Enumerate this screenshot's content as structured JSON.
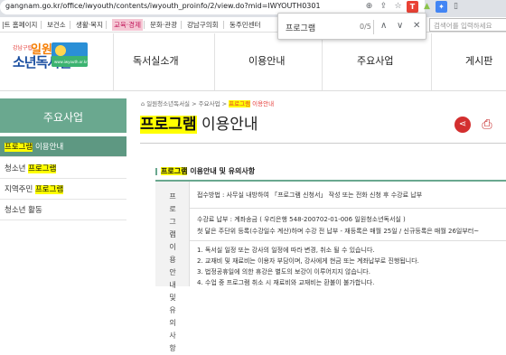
{
  "browser": {
    "url": "gangnam.go.kr/office/iwyouth/contents/iwyouth_proinfo/2/view.do?mid=IWYOUTH0301",
    "find_query": "프로그램",
    "find_count": "0/5",
    "bookmarks": [
      "|트 홈페이지",
      "보건소",
      "생활·복지",
      "교육·경제",
      "문화·관광",
      "강남구의회",
      "동주민센터"
    ],
    "active_bookmark_index": 3,
    "search_placeholder": "검색어를 입력하세요"
  },
  "logo": {
    "small": "강남구립",
    "big": "일원",
    "main": "소년독서실",
    "mark_text": "www.iwyouth.or.kr"
  },
  "nav": [
    "독서실소개",
    "이용안내",
    "주요사업",
    "게시판"
  ],
  "sidebar": {
    "title": "주요사업",
    "items": [
      {
        "pre": "",
        "hl": "프로그램",
        "post": " 이용안내"
      },
      {
        "pre": "청소년 ",
        "hl": "프로그램",
        "post": ""
      },
      {
        "pre": "지역주민 ",
        "hl": "프로그램",
        "post": ""
      },
      {
        "pre": "청소년 활동",
        "hl": "",
        "post": ""
      }
    ]
  },
  "breadcrumb": {
    "home": "⌂ 일원청소년독서실",
    "sep": " > ",
    "mid": "주요사업",
    "cur_hl": "프로그램",
    "cur_rest": " 이용안내"
  },
  "page_title": {
    "hl": "프로그램",
    "rest": " 이용안내"
  },
  "section": {
    "heading_hl": "프로그램",
    "heading_rest": " 이용안내 및 유의사항",
    "header_cell": "프로그램 이용안내 및 유의사항",
    "row1": "접수방법 : 사무실 내방하여 「프로그램 신청서」 작성 또는 전화 신청 후 수강료 납부",
    "row2a": "수강료 납부 : 계좌송금 ( 우리은행 548-200702-01-006 일원청소년독서실 )",
    "row2b": "첫 달은 주단위 등록(수강일수 계산)하며 수강 전 납부 - 재등록은 매월 25일 / 신규등록은 매월 26일부터~",
    "notes": [
      "1. 독서실 일정 또는 강사의 일정에 따라 변경, 취소 될 수 있습니다.",
      "2. 교재비 및 재료비는 이용자 부담이며, 강사에게 현금 또는 계좌납부로 진행됩니다.",
      "3. 법정공휴일에 의한 휴강은 별도의 보강이 이루어지지 않습니다.",
      "4. 수업 중 프로그램 취소 시 재료비와 교재비는 환불이 불가합니다."
    ]
  }
}
